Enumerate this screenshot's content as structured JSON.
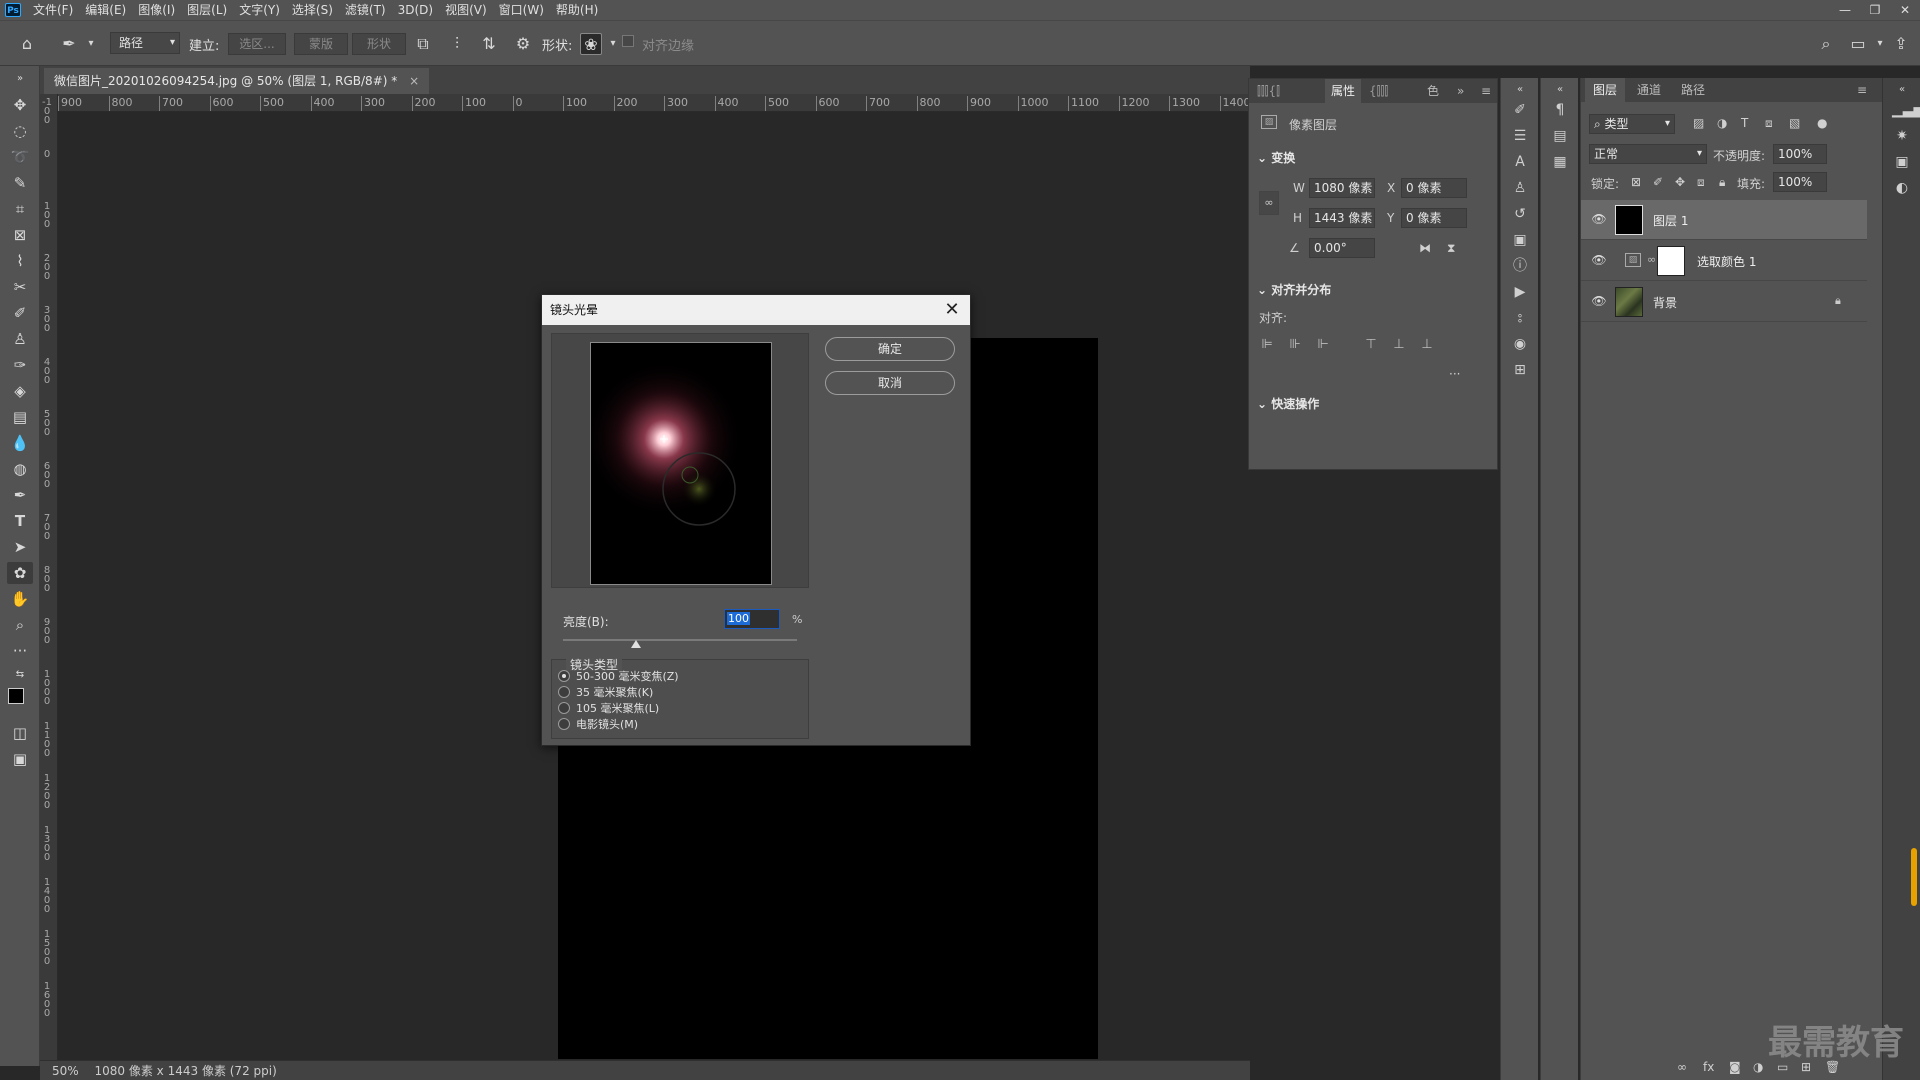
{
  "app": {
    "logo": "Ps",
    "menu": [
      "文件(F)",
      "编辑(E)",
      "图像(I)",
      "图层(L)",
      "文字(Y)",
      "选择(S)",
      "滤镜(T)",
      "3D(D)",
      "视图(V)",
      "窗口(W)",
      "帮助(H)"
    ]
  },
  "options_bar": {
    "mode_select": "路径",
    "create_label": "建立:",
    "selection_btn": "选区...",
    "mask_btn": "蒙版",
    "shape_btn": "形状",
    "shape_label": "形状:",
    "align_edges": "对齐边缘"
  },
  "document": {
    "tab_title": "微信图片_20201026094254.jpg @ 50% (图层 1, RGB/8#) *",
    "status_zoom": "50%",
    "status_info": "1080 像素 x 1443 像素 (72 ppi)"
  },
  "ruler": {
    "h_ticks": [
      "900",
      "800",
      "700",
      "600",
      "500",
      "400",
      "300",
      "200",
      "100",
      "0",
      "100",
      "200",
      "300",
      "400",
      "500",
      "600",
      "700",
      "800",
      "900",
      "1000",
      "1100",
      "1200",
      "1300",
      "1400"
    ],
    "v_ticks": [
      "-100",
      "0",
      "100",
      "200",
      "300",
      "400",
      "500",
      "600",
      "700",
      "800",
      "900",
      "1000",
      "1100",
      "1200",
      "1300",
      "1400",
      "1500",
      "1600"
    ]
  },
  "dialog": {
    "title": "镜头光晕",
    "ok": "确定",
    "cancel": "取消",
    "brightness_label": "亮度(B):",
    "brightness_value": "100",
    "brightness_unit": "%",
    "brightness_level": 100,
    "lens_type_label": "镜头类型",
    "lens_options": [
      {
        "label": "50-300 毫米变焦(Z)",
        "selected": true
      },
      {
        "label": "35 毫米聚焦(K)",
        "selected": false
      },
      {
        "label": "105 毫米聚焦(L)",
        "selected": false
      },
      {
        "label": "电影镜头(M)",
        "selected": false
      }
    ]
  },
  "properties": {
    "tab_active": "属性",
    "tab_other": "色",
    "pixel_layer": "像素图层",
    "transform": "变换",
    "w_label": "W",
    "w_value": "1080 像素",
    "h_label": "H",
    "h_value": "1443 像素",
    "x_label": "X",
    "x_value": "0 像素",
    "y_label": "Y",
    "y_value": "0 像素",
    "angle_value": "0.00°",
    "align_distribute": "对齐并分布",
    "align_label": "对齐:",
    "more": "···",
    "quick_actions": "快速操作"
  },
  "layers": {
    "tabs": [
      "图层",
      "通道",
      "路径"
    ],
    "filter_kind": "类型",
    "blend_mode": "正常",
    "opacity_label": "不透明度:",
    "opacity_value": "100%",
    "lock_label": "锁定:",
    "fill_label": "填充:",
    "fill_value": "100%",
    "items": [
      {
        "name": "图层 1",
        "selected": true
      },
      {
        "name": "选取颜色 1",
        "selected": false
      },
      {
        "name": "背景",
        "selected": false
      }
    ]
  },
  "watermark": "最需教育",
  "colors": {
    "panel": "#535353",
    "canvas_bg": "#282828",
    "accent": "#1c6bd6"
  }
}
